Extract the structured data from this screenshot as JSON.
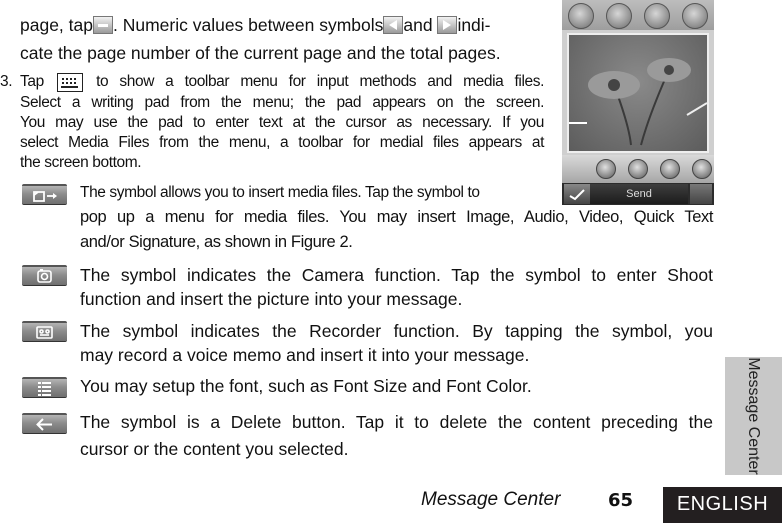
{
  "paragraph_top": {
    "line1_a": "page, tap",
    "line1_b": ". Numeric values between symbols",
    "line1_c": "and ",
    "line1_d": "indi-",
    "line2": "cate the page number of the current page and the total pages."
  },
  "step3": {
    "number": "3.",
    "tap": "Tap",
    "lines": [
      "to show a toolbar menu for input methods and media files.",
      "Select a writing pad from the menu; the pad appears on the screen.",
      "You may use the pad to enter text at the cursor as necessary. If you",
      "select Media Files from the menu, a toolbar for medial files appears at",
      "the screen bottom."
    ]
  },
  "symbols": [
    {
      "icon": "insert-media-icon",
      "lines": [
        "The symbol allows you to insert media files. Tap the symbol to",
        "pop up a menu for media files. You may insert Image, Audio, Video, Quick Text",
        "and/or Signature, as shown in Figure 2."
      ]
    },
    {
      "icon": "camera-icon",
      "lines": [
        "The symbol indicates the Camera function. Tap the symbol to enter Shoot",
        "function and insert the picture into your message."
      ]
    },
    {
      "icon": "recorder-icon",
      "lines": [
        "The symbol indicates the Recorder function. By tapping the symbol, you",
        "may record a voice memo and insert it into your message."
      ]
    },
    {
      "icon": "font-settings-icon",
      "lines": [
        "You may setup the font, such as Font Size and Font Color."
      ]
    },
    {
      "icon": "delete-arrow-icon",
      "lines": [
        "The symbol is a Delete button. Tap it to delete the content preceding the",
        "cursor or the content you selected."
      ]
    }
  ],
  "phone_screenshot": {
    "top_buttons": [
      "home-icon",
      "phonebook-icon",
      "help-icon",
      "end-call-icon"
    ],
    "media_buttons": [
      "previous-track-icon",
      "play-icon",
      "next-track-icon",
      "volume-icon"
    ],
    "send_label": "Send"
  },
  "side_tab": "Message Center",
  "footer": {
    "section": "Message Center",
    "page": "65",
    "language": "ENGLISH"
  }
}
